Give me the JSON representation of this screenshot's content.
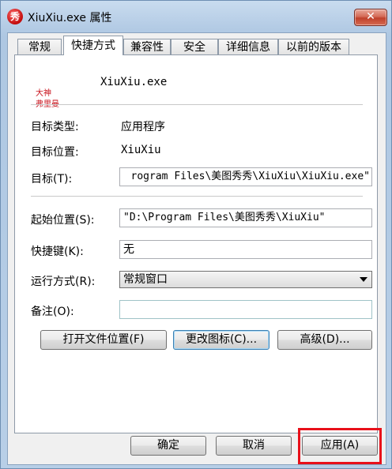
{
  "window": {
    "title": "XiuXiu.exe 属性",
    "close_glyph": "✕",
    "icon_glyph": "秀"
  },
  "tabs": [
    {
      "label": "常规"
    },
    {
      "label": "快捷方式"
    },
    {
      "label": "兼容性"
    },
    {
      "label": "安全"
    },
    {
      "label": "详细信息"
    },
    {
      "label": "以前的版本"
    }
  ],
  "shortcut": {
    "icon_text_line1": "大神",
    "icon_text_line2": "弗里曼",
    "name": "XiuXiu.exe",
    "target_type_label": "目标类型:",
    "target_type_value": "应用程序",
    "target_location_label": "目标位置:",
    "target_location_value": "XiuXiu",
    "target_label": "目标(T):",
    "target_value": "rogram Files\\美图秀秀\\XiuXiu\\XiuXiu.exe\"",
    "start_in_label": "起始位置(S):",
    "start_in_value": "\"D:\\Program Files\\美图秀秀\\XiuXiu\"",
    "hotkey_label": "快捷键(K):",
    "hotkey_value": "无",
    "run_label": "运行方式(R):",
    "run_value": "常规窗口",
    "comment_label": "备注(O):",
    "comment_value": ""
  },
  "actions": {
    "open_location": "打开文件位置(F)",
    "change_icon": "更改图标(C)...",
    "advanced": "高级(D)..."
  },
  "footer": {
    "ok": "确定",
    "cancel": "取消",
    "apply": "应用(A)"
  },
  "colors": {
    "highlight": "#e8101a",
    "title_gradient": "#b6cde6"
  }
}
